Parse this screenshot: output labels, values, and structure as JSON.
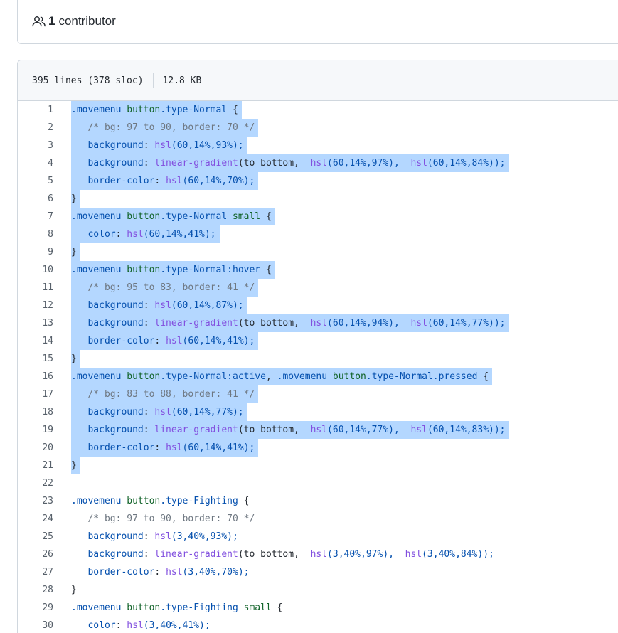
{
  "contributors": {
    "count": "1",
    "label": "contributor"
  },
  "file_info": {
    "lines": "395 lines (378 sloc)",
    "size": "12.8 KB"
  },
  "colors": {
    "selection": "#b4d7ff",
    "selector": "#0550ae",
    "function": "#8250df",
    "comment": "#6e7781",
    "element": "#116329"
  },
  "code_lines": [
    {
      "n": "1",
      "sel": true,
      "tokens": [
        {
          "t": ".movemenu ",
          "c": "sel"
        },
        {
          "t": "button",
          "c": "tag"
        },
        {
          "t": ".type-Normal",
          "c": "sel"
        },
        {
          "t": " {",
          "c": "plain"
        }
      ]
    },
    {
      "n": "2",
      "sel": true,
      "tokens": [
        {
          "t": "   /* bg: 97 to 90, border: 70 */",
          "c": "com"
        }
      ]
    },
    {
      "n": "3",
      "sel": true,
      "tokens": [
        {
          "t": "   background",
          "c": "prop"
        },
        {
          "t": ": ",
          "c": "plain"
        },
        {
          "t": "hsl",
          "c": "fn"
        },
        {
          "t": "(60,14%,93%);",
          "c": "num"
        }
      ]
    },
    {
      "n": "4",
      "sel": true,
      "tokens": [
        {
          "t": "   background",
          "c": "prop"
        },
        {
          "t": ": ",
          "c": "plain"
        },
        {
          "t": "linear-gradient",
          "c": "fn"
        },
        {
          "t": "(to bottom,  ",
          "c": "plain"
        },
        {
          "t": "hsl",
          "c": "fn"
        },
        {
          "t": "(60,14%,97%),  ",
          "c": "num"
        },
        {
          "t": "hsl",
          "c": "fn"
        },
        {
          "t": "(60,14%,84%));",
          "c": "num"
        }
      ]
    },
    {
      "n": "5",
      "sel": true,
      "tokens": [
        {
          "t": "   border-color",
          "c": "prop"
        },
        {
          "t": ": ",
          "c": "plain"
        },
        {
          "t": "hsl",
          "c": "fn"
        },
        {
          "t": "(60,14%,70%);",
          "c": "num"
        }
      ]
    },
    {
      "n": "6",
      "sel": true,
      "tokens": [
        {
          "t": "}",
          "c": "plain"
        }
      ]
    },
    {
      "n": "7",
      "sel": true,
      "tokens": [
        {
          "t": ".movemenu ",
          "c": "sel"
        },
        {
          "t": "button",
          "c": "tag"
        },
        {
          "t": ".type-Normal ",
          "c": "sel"
        },
        {
          "t": "small",
          "c": "tag"
        },
        {
          "t": " {",
          "c": "plain"
        }
      ]
    },
    {
      "n": "8",
      "sel": true,
      "tokens": [
        {
          "t": "   color",
          "c": "prop"
        },
        {
          "t": ": ",
          "c": "plain"
        },
        {
          "t": "hsl",
          "c": "fn"
        },
        {
          "t": "(60,14%,41%);",
          "c": "num"
        }
      ]
    },
    {
      "n": "9",
      "sel": true,
      "tokens": [
        {
          "t": "}",
          "c": "plain"
        }
      ]
    },
    {
      "n": "10",
      "sel": true,
      "tokens": [
        {
          "t": ".movemenu ",
          "c": "sel"
        },
        {
          "t": "button",
          "c": "tag"
        },
        {
          "t": ".type-Normal:hover",
          "c": "sel"
        },
        {
          "t": " {",
          "c": "plain"
        }
      ]
    },
    {
      "n": "11",
      "sel": true,
      "tokens": [
        {
          "t": "   /* bg: 95 to 83, border: 41 */",
          "c": "com"
        }
      ]
    },
    {
      "n": "12",
      "sel": true,
      "tokens": [
        {
          "t": "   background",
          "c": "prop"
        },
        {
          "t": ": ",
          "c": "plain"
        },
        {
          "t": "hsl",
          "c": "fn"
        },
        {
          "t": "(60,14%,87%);",
          "c": "num"
        }
      ]
    },
    {
      "n": "13",
      "sel": true,
      "tokens": [
        {
          "t": "   background",
          "c": "prop"
        },
        {
          "t": ": ",
          "c": "plain"
        },
        {
          "t": "linear-gradient",
          "c": "fn"
        },
        {
          "t": "(to bottom,  ",
          "c": "plain"
        },
        {
          "t": "hsl",
          "c": "fn"
        },
        {
          "t": "(60,14%,94%),  ",
          "c": "num"
        },
        {
          "t": "hsl",
          "c": "fn"
        },
        {
          "t": "(60,14%,77%));",
          "c": "num"
        }
      ]
    },
    {
      "n": "14",
      "sel": true,
      "tokens": [
        {
          "t": "   border-color",
          "c": "prop"
        },
        {
          "t": ": ",
          "c": "plain"
        },
        {
          "t": "hsl",
          "c": "fn"
        },
        {
          "t": "(60,14%,41%);",
          "c": "num"
        }
      ]
    },
    {
      "n": "15",
      "sel": true,
      "tokens": [
        {
          "t": "}",
          "c": "plain"
        }
      ]
    },
    {
      "n": "16",
      "sel": true,
      "tokens": [
        {
          "t": ".movemenu ",
          "c": "sel"
        },
        {
          "t": "button",
          "c": "tag"
        },
        {
          "t": ".type-Normal:active",
          "c": "sel"
        },
        {
          "t": ", ",
          "c": "plain"
        },
        {
          "t": ".movemenu ",
          "c": "sel"
        },
        {
          "t": "button",
          "c": "tag"
        },
        {
          "t": ".type-Normal.pressed",
          "c": "sel"
        },
        {
          "t": " {",
          "c": "plain"
        }
      ]
    },
    {
      "n": "17",
      "sel": true,
      "tokens": [
        {
          "t": "   /* bg: 83 to 88, border: 41 */",
          "c": "com"
        }
      ]
    },
    {
      "n": "18",
      "sel": true,
      "tokens": [
        {
          "t": "   background",
          "c": "prop"
        },
        {
          "t": ": ",
          "c": "plain"
        },
        {
          "t": "hsl",
          "c": "fn"
        },
        {
          "t": "(60,14%,77%);",
          "c": "num"
        }
      ]
    },
    {
      "n": "19",
      "sel": true,
      "tokens": [
        {
          "t": "   background",
          "c": "prop"
        },
        {
          "t": ": ",
          "c": "plain"
        },
        {
          "t": "linear-gradient",
          "c": "fn"
        },
        {
          "t": "(to bottom,  ",
          "c": "plain"
        },
        {
          "t": "hsl",
          "c": "fn"
        },
        {
          "t": "(60,14%,77%),  ",
          "c": "num"
        },
        {
          "t": "hsl",
          "c": "fn"
        },
        {
          "t": "(60,14%,83%));",
          "c": "num"
        }
      ]
    },
    {
      "n": "20",
      "sel": true,
      "tokens": [
        {
          "t": "   border-color",
          "c": "prop"
        },
        {
          "t": ": ",
          "c": "plain"
        },
        {
          "t": "hsl",
          "c": "fn"
        },
        {
          "t": "(60,14%,41%);",
          "c": "num"
        }
      ]
    },
    {
      "n": "21",
      "sel": true,
      "tokens": [
        {
          "t": "}",
          "c": "plain"
        }
      ]
    },
    {
      "n": "22",
      "sel": false,
      "tokens": []
    },
    {
      "n": "23",
      "sel": false,
      "tokens": [
        {
          "t": ".movemenu ",
          "c": "sel"
        },
        {
          "t": "button",
          "c": "tag"
        },
        {
          "t": ".type-Fighting",
          "c": "sel"
        },
        {
          "t": " {",
          "c": "plain"
        }
      ]
    },
    {
      "n": "24",
      "sel": false,
      "tokens": [
        {
          "t": "   /* bg: 97 to 90, border: 70 */",
          "c": "com"
        }
      ]
    },
    {
      "n": "25",
      "sel": false,
      "tokens": [
        {
          "t": "   background",
          "c": "prop"
        },
        {
          "t": ": ",
          "c": "plain"
        },
        {
          "t": "hsl",
          "c": "fn"
        },
        {
          "t": "(3,40%,93%);",
          "c": "num"
        }
      ]
    },
    {
      "n": "26",
      "sel": false,
      "tokens": [
        {
          "t": "   background",
          "c": "prop"
        },
        {
          "t": ": ",
          "c": "plain"
        },
        {
          "t": "linear-gradient",
          "c": "fn"
        },
        {
          "t": "(to bottom,  ",
          "c": "plain"
        },
        {
          "t": "hsl",
          "c": "fn"
        },
        {
          "t": "(3,40%,97%),  ",
          "c": "num"
        },
        {
          "t": "hsl",
          "c": "fn"
        },
        {
          "t": "(3,40%,84%));",
          "c": "num"
        }
      ]
    },
    {
      "n": "27",
      "sel": false,
      "tokens": [
        {
          "t": "   border-color",
          "c": "prop"
        },
        {
          "t": ": ",
          "c": "plain"
        },
        {
          "t": "hsl",
          "c": "fn"
        },
        {
          "t": "(3,40%,70%);",
          "c": "num"
        }
      ]
    },
    {
      "n": "28",
      "sel": false,
      "tokens": [
        {
          "t": "}",
          "c": "plain"
        }
      ]
    },
    {
      "n": "29",
      "sel": false,
      "tokens": [
        {
          "t": ".movemenu ",
          "c": "sel"
        },
        {
          "t": "button",
          "c": "tag"
        },
        {
          "t": ".type-Fighting ",
          "c": "sel"
        },
        {
          "t": "small",
          "c": "tag"
        },
        {
          "t": " {",
          "c": "plain"
        }
      ]
    },
    {
      "n": "30",
      "sel": false,
      "tokens": [
        {
          "t": "   color",
          "c": "prop"
        },
        {
          "t": ": ",
          "c": "plain"
        },
        {
          "t": "hsl",
          "c": "fn"
        },
        {
          "t": "(3,40%,41%);",
          "c": "num"
        }
      ]
    }
  ]
}
